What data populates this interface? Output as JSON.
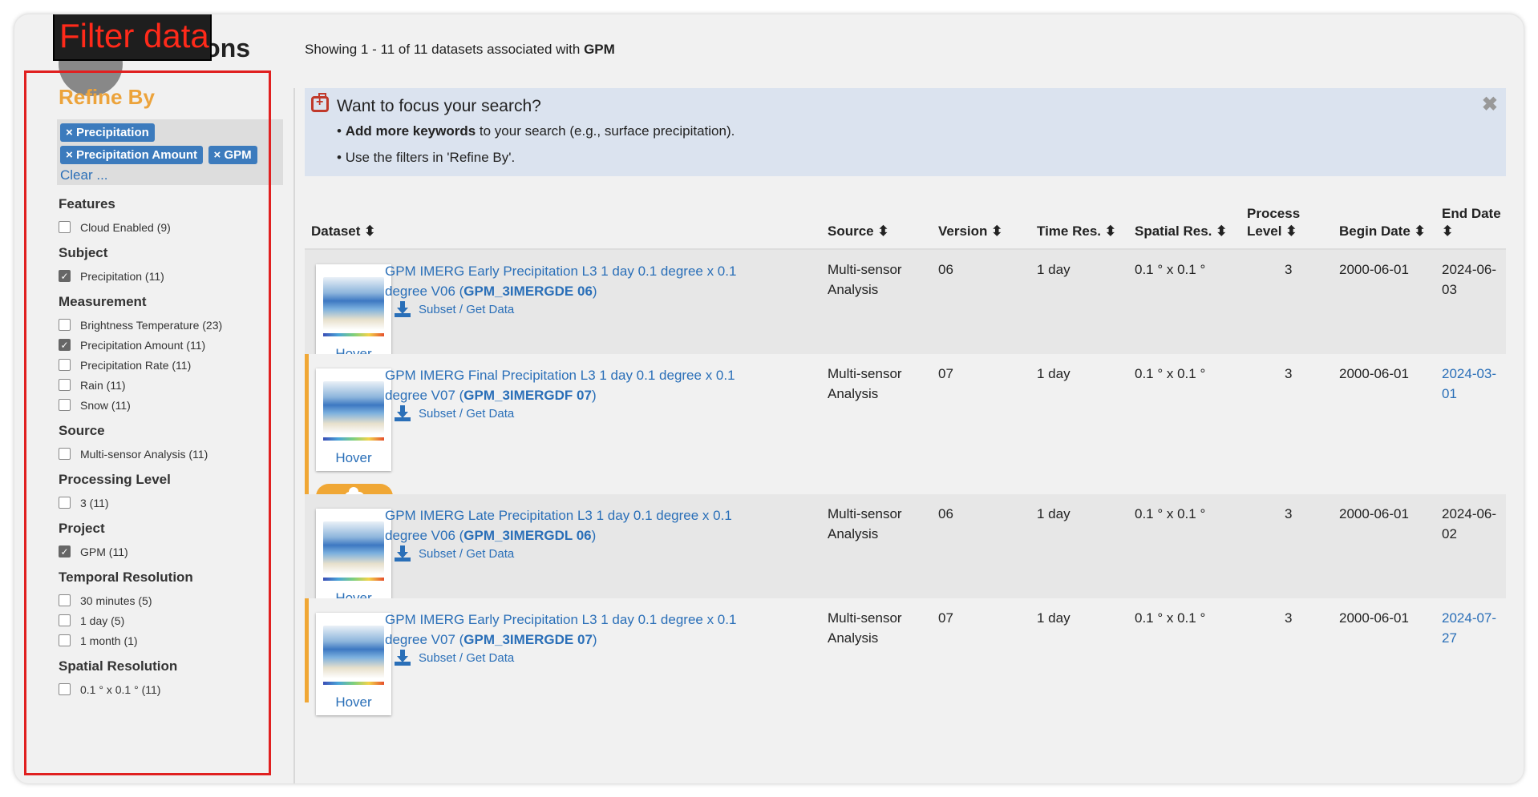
{
  "overlay_label": "Filter data",
  "page": {
    "title": "ections",
    "showing_prefix": "Showing 1 - 11 of 11 datasets associated with ",
    "showing_keyword": "GPM"
  },
  "sidebar": {
    "heading": "Refine By",
    "chips": [
      "Precipitation",
      "Precipitation Amount",
      "GPM"
    ],
    "chip_remove_icon": "×",
    "clear": "Clear ...",
    "facets": [
      {
        "title": "Features",
        "items": [
          {
            "label": "Cloud Enabled (9)",
            "checked": false
          }
        ]
      },
      {
        "title": "Subject",
        "items": [
          {
            "label": "Precipitation (11)",
            "checked": true
          }
        ]
      },
      {
        "title": "Measurement",
        "items": [
          {
            "label": "Brightness Temperature (23)",
            "checked": false
          },
          {
            "label": "Precipitation Amount (11)",
            "checked": true
          },
          {
            "label": "Precipitation Rate (11)",
            "checked": false
          },
          {
            "label": "Rain (11)",
            "checked": false
          },
          {
            "label": "Snow (11)",
            "checked": false
          }
        ]
      },
      {
        "title": "Source",
        "items": [
          {
            "label": "Multi-sensor Analysis (11)",
            "checked": false
          }
        ]
      },
      {
        "title": "Processing Level",
        "items": [
          {
            "label": "3 (11)",
            "checked": false
          }
        ]
      },
      {
        "title": "Project",
        "items": [
          {
            "label": "GPM (11)",
            "checked": true
          }
        ]
      },
      {
        "title": "Temporal Resolution",
        "items": [
          {
            "label": "30 minutes (5)",
            "checked": false
          },
          {
            "label": "1 day (5)",
            "checked": false
          },
          {
            "label": "1 month (1)",
            "checked": false
          }
        ]
      },
      {
        "title": "Spatial Resolution",
        "items": [
          {
            "label": "0.1 ° x 0.1 ° (11)",
            "checked": false
          }
        ]
      }
    ]
  },
  "focus": {
    "title": "Want to focus your search?",
    "line1_bold": "Add more keywords",
    "line1_rest": " to your search (e.g., surface precipitation).",
    "line2": "Use the filters in 'Refine By'.",
    "bullet": "•",
    "close": "✖"
  },
  "table": {
    "headers": {
      "dataset": "Dataset",
      "source": "Source",
      "version": "Version",
      "time_res": "Time Res.",
      "spatial_res": "Spatial Res.",
      "process_level_1": "Process",
      "process_level_2": "Level",
      "begin_date": "Begin Date",
      "end_date": "End Date",
      "sort_icon": "⬍"
    },
    "hover_label": "Hover",
    "subset_label": "Subset / Get Data",
    "rows": [
      {
        "name_line1": "GPM IMERG Early Precipitation L3 1 day 0.1 degree x 0.1",
        "name_line2_pre": "degree V06 (",
        "short": "GPM_3IMERGDE 06",
        "name_line2_post": ")",
        "source1": "Multi-sensor",
        "source2": "Analysis",
        "version": "06",
        "time_res": "1 day",
        "spatial_res": "0.1 ° x 0.1 °",
        "level": "3",
        "begin": "2000-06-01",
        "end": "2024-06-03",
        "end_link": false,
        "cloud": false
      },
      {
        "name_line1": "GPM IMERG Final Precipitation L3 1 day 0.1 degree x 0.1",
        "name_line2_pre": "degree V07 (",
        "short": "GPM_3IMERGDF 07",
        "name_line2_post": ")",
        "source1": "Multi-sensor",
        "source2": "Analysis",
        "version": "07",
        "time_res": "1 day",
        "spatial_res": "0.1 ° x 0.1 °",
        "level": "3",
        "begin": "2000-06-01",
        "end": "2024-03-01",
        "end_link": true,
        "cloud": true
      },
      {
        "name_line1": "GPM IMERG Late Precipitation L3 1 day 0.1 degree x 0.1",
        "name_line2_pre": "degree V06 (",
        "short": "GPM_3IMERGDL 06",
        "name_line2_post": ")",
        "source1": "Multi-sensor",
        "source2": "Analysis",
        "version": "06",
        "time_res": "1 day",
        "spatial_res": "0.1 ° x 0.1 °",
        "level": "3",
        "begin": "2000-06-01",
        "end": "2024-06-02",
        "end_link": false,
        "cloud": false
      },
      {
        "name_line1": "GPM IMERG Early Precipitation L3 1 day 0.1 degree x 0.1",
        "name_line2_pre": "degree V07 (",
        "short": "GPM_3IMERGDE 07",
        "name_line2_post": ")",
        "source1": "Multi-sensor",
        "source2": "Analysis",
        "version": "07",
        "time_res": "1 day",
        "spatial_res": "0.1 ° x 0.1 °",
        "level": "3",
        "begin": "2000-06-01",
        "end": "2024-07-27",
        "end_link": true,
        "cloud": false
      }
    ]
  },
  "colors": {
    "accent": "#eca33b",
    "link": "#2a6fb8",
    "chip": "#3c7bbd",
    "highlight": "#e02020"
  }
}
